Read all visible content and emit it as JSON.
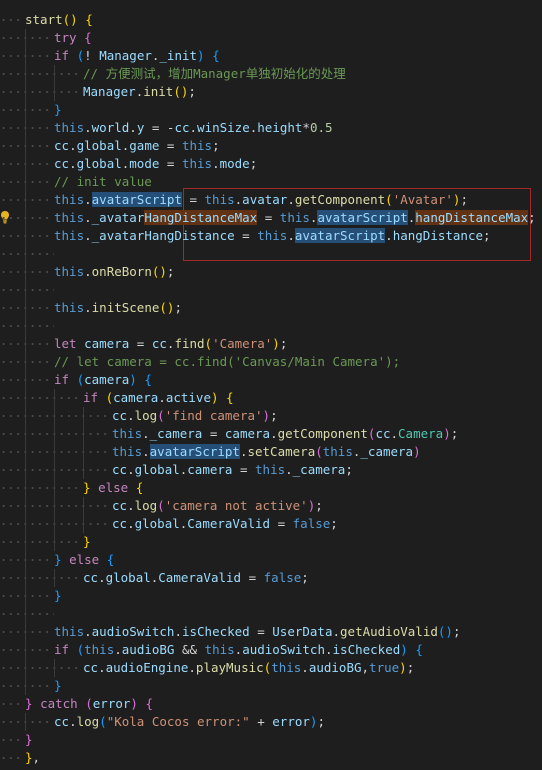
{
  "editor": {
    "language": "javascript",
    "lines": [
      {
        "indent": 0,
        "tokens": [
          [
            "fn",
            "start"
          ],
          [
            "br1",
            "()"
          ],
          [
            "gc",
            " "
          ],
          [
            "br1",
            "{"
          ]
        ]
      },
      {
        "indent": 1,
        "tokens": [
          [
            "kw",
            "try"
          ],
          [
            "gc",
            " "
          ],
          [
            "br2",
            "{"
          ]
        ]
      },
      {
        "indent": 1,
        "tokens": [
          [
            "kw",
            "if"
          ],
          [
            "gc",
            " "
          ],
          [
            "br3",
            "("
          ],
          [
            "gc",
            "! "
          ],
          [
            "pr",
            "Manager"
          ],
          [
            "gc",
            "."
          ],
          [
            "pr",
            "_init"
          ],
          [
            "br3",
            ")"
          ],
          [
            "gc",
            " "
          ],
          [
            "br3",
            "{"
          ]
        ]
      },
      {
        "indent": 2,
        "tokens": [
          [
            "cm",
            "// 方便测试，增加Manager单独初始化的处理"
          ]
        ]
      },
      {
        "indent": 2,
        "tokens": [
          [
            "pr",
            "Manager"
          ],
          [
            "gc",
            "."
          ],
          [
            "fn",
            "init"
          ],
          [
            "br1",
            "()"
          ],
          [
            "gc",
            ";"
          ]
        ]
      },
      {
        "indent": 1,
        "tokens": [
          [
            "br3",
            "}"
          ]
        ]
      },
      {
        "indent": 1,
        "tokens": [
          [
            "this",
            "this"
          ],
          [
            "gc",
            "."
          ],
          [
            "pr",
            "world"
          ],
          [
            "gc",
            "."
          ],
          [
            "pr",
            "y"
          ],
          [
            "gc",
            " = -"
          ],
          [
            "pr",
            "cc"
          ],
          [
            "gc",
            "."
          ],
          [
            "pr",
            "winSize"
          ],
          [
            "gc",
            "."
          ],
          [
            "pr",
            "height"
          ],
          [
            "gc",
            "*"
          ],
          [
            "num",
            "0.5"
          ]
        ]
      },
      {
        "indent": 1,
        "tokens": [
          [
            "pr",
            "cc"
          ],
          [
            "gc",
            "."
          ],
          [
            "pr",
            "global"
          ],
          [
            "gc",
            "."
          ],
          [
            "pr",
            "game"
          ],
          [
            "gc",
            " = "
          ],
          [
            "this",
            "this"
          ],
          [
            "gc",
            ";"
          ]
        ]
      },
      {
        "indent": 1,
        "tokens": [
          [
            "pr",
            "cc"
          ],
          [
            "gc",
            "."
          ],
          [
            "pr",
            "global"
          ],
          [
            "gc",
            "."
          ],
          [
            "pr",
            "mode"
          ],
          [
            "gc",
            " = "
          ],
          [
            "this",
            "this"
          ],
          [
            "gc",
            "."
          ],
          [
            "pr",
            "mode"
          ],
          [
            "gc",
            ";"
          ]
        ]
      },
      {
        "indent": 1,
        "tokens": [
          [
            "cm",
            "// init value"
          ]
        ]
      },
      {
        "indent": 1,
        "tokens": [
          [
            "this",
            "this"
          ],
          [
            "gc",
            "."
          ],
          [
            "pr hl",
            "avatarScript"
          ],
          [
            "gc",
            " = "
          ],
          [
            "this",
            "this"
          ],
          [
            "gc",
            "."
          ],
          [
            "pr",
            "avatar"
          ],
          [
            "gc",
            "."
          ],
          [
            "fn",
            "getComponent"
          ],
          [
            "br1",
            "("
          ],
          [
            "str",
            "'Avatar'"
          ],
          [
            "br1",
            ")"
          ],
          [
            "gc",
            ";"
          ]
        ]
      },
      {
        "indent": 1,
        "tokens": [
          [
            "this",
            "this"
          ],
          [
            "gc",
            "."
          ],
          [
            "pr",
            "_avatar"
          ],
          [
            "pr hl2",
            "HangDistanceMax"
          ],
          [
            "gc",
            " = "
          ],
          [
            "this",
            "this"
          ],
          [
            "gc",
            "."
          ],
          [
            "pr hl",
            "avatarScript"
          ],
          [
            "gc",
            "."
          ],
          [
            "pr hl2",
            "hangDistanceMax"
          ],
          [
            "gc",
            ";"
          ]
        ]
      },
      {
        "indent": 1,
        "tokens": [
          [
            "this",
            "this"
          ],
          [
            "gc",
            "."
          ],
          [
            "pr",
            "_avatarHangDistance"
          ],
          [
            "gc",
            " = "
          ],
          [
            "this",
            "this"
          ],
          [
            "gc",
            "."
          ],
          [
            "pr hl",
            "avatarScript"
          ],
          [
            "gc",
            "."
          ],
          [
            "pr",
            "hangDistance"
          ],
          [
            "gc",
            ";"
          ]
        ]
      },
      {
        "indent": 1,
        "tokens": []
      },
      {
        "indent": 1,
        "tokens": [
          [
            "this",
            "this"
          ],
          [
            "gc",
            "."
          ],
          [
            "fn",
            "onReBorn"
          ],
          [
            "br1",
            "()"
          ],
          [
            "gc",
            ";"
          ]
        ]
      },
      {
        "indent": 1,
        "tokens": []
      },
      {
        "indent": 1,
        "tokens": [
          [
            "this",
            "this"
          ],
          [
            "gc",
            "."
          ],
          [
            "fn",
            "initScene"
          ],
          [
            "br1",
            "()"
          ],
          [
            "gc",
            ";"
          ]
        ]
      },
      {
        "indent": 1,
        "tokens": []
      },
      {
        "indent": 1,
        "tokens": [
          [
            "kw",
            "let"
          ],
          [
            "gc",
            " "
          ],
          [
            "pr",
            "camera"
          ],
          [
            "gc",
            " = "
          ],
          [
            "pr",
            "cc"
          ],
          [
            "gc",
            "."
          ],
          [
            "fn",
            "find"
          ],
          [
            "br1",
            "("
          ],
          [
            "str",
            "'Camera'"
          ],
          [
            "br1",
            ")"
          ],
          [
            "gc",
            ";"
          ]
        ]
      },
      {
        "indent": 1,
        "tokens": [
          [
            "cm",
            "// let camera = cc.find('Canvas/Main Camera');"
          ]
        ]
      },
      {
        "indent": 1,
        "tokens": [
          [
            "kw",
            "if"
          ],
          [
            "gc",
            " "
          ],
          [
            "br3",
            "("
          ],
          [
            "pr",
            "camera"
          ],
          [
            "br3",
            ")"
          ],
          [
            "gc",
            " "
          ],
          [
            "br3",
            "{"
          ]
        ]
      },
      {
        "indent": 2,
        "tokens": [
          [
            "kw",
            "if"
          ],
          [
            "gc",
            " "
          ],
          [
            "br1",
            "("
          ],
          [
            "pr",
            "camera"
          ],
          [
            "gc",
            "."
          ],
          [
            "pr",
            "active"
          ],
          [
            "br1",
            ")"
          ],
          [
            "gc",
            " "
          ],
          [
            "br1",
            "{"
          ]
        ]
      },
      {
        "indent": 3,
        "tokens": [
          [
            "pr",
            "cc"
          ],
          [
            "gc",
            "."
          ],
          [
            "fn",
            "log"
          ],
          [
            "br2",
            "("
          ],
          [
            "str",
            "'find camera'"
          ],
          [
            "br2",
            ")"
          ],
          [
            "gc",
            ";"
          ]
        ]
      },
      {
        "indent": 3,
        "tokens": [
          [
            "this",
            "this"
          ],
          [
            "gc",
            "."
          ],
          [
            "pr",
            "_camera"
          ],
          [
            "gc",
            " = "
          ],
          [
            "pr",
            "camera"
          ],
          [
            "gc",
            "."
          ],
          [
            "fn",
            "getComponent"
          ],
          [
            "br2",
            "("
          ],
          [
            "pr",
            "cc"
          ],
          [
            "gc",
            "."
          ],
          [
            "cls",
            "Camera"
          ],
          [
            "br2",
            ")"
          ],
          [
            "gc",
            ";"
          ]
        ]
      },
      {
        "indent": 3,
        "tokens": [
          [
            "this",
            "this"
          ],
          [
            "gc",
            "."
          ],
          [
            "pr hl",
            "avatarScript"
          ],
          [
            "gc",
            "."
          ],
          [
            "fn",
            "setCamera"
          ],
          [
            "br2",
            "("
          ],
          [
            "this",
            "this"
          ],
          [
            "gc",
            "."
          ],
          [
            "pr",
            "_camera"
          ],
          [
            "br2",
            ")"
          ]
        ]
      },
      {
        "indent": 3,
        "tokens": [
          [
            "pr",
            "cc"
          ],
          [
            "gc",
            "."
          ],
          [
            "pr",
            "global"
          ],
          [
            "gc",
            "."
          ],
          [
            "pr",
            "camera"
          ],
          [
            "gc",
            " = "
          ],
          [
            "this",
            "this"
          ],
          [
            "gc",
            "."
          ],
          [
            "pr",
            "_camera"
          ],
          [
            "gc",
            ";"
          ]
        ]
      },
      {
        "indent": 2,
        "tokens": [
          [
            "br1",
            "}"
          ],
          [
            "gc",
            " "
          ],
          [
            "kw",
            "else"
          ],
          [
            "gc",
            " "
          ],
          [
            "br1",
            "{"
          ]
        ]
      },
      {
        "indent": 3,
        "tokens": [
          [
            "pr",
            "cc"
          ],
          [
            "gc",
            "."
          ],
          [
            "fn",
            "log"
          ],
          [
            "br2",
            "("
          ],
          [
            "str",
            "'camera not active'"
          ],
          [
            "br2",
            ")"
          ],
          [
            "gc",
            ";"
          ]
        ]
      },
      {
        "indent": 3,
        "tokens": [
          [
            "pr",
            "cc"
          ],
          [
            "gc",
            "."
          ],
          [
            "pr",
            "global"
          ],
          [
            "gc",
            "."
          ],
          [
            "pr",
            "CameraValid"
          ],
          [
            "gc",
            " = "
          ],
          [
            "this",
            "false"
          ],
          [
            "gc",
            ";"
          ]
        ]
      },
      {
        "indent": 2,
        "tokens": [
          [
            "br1",
            "}"
          ]
        ]
      },
      {
        "indent": 1,
        "tokens": [
          [
            "br3",
            "}"
          ],
          [
            "gc",
            " "
          ],
          [
            "kw",
            "else"
          ],
          [
            "gc",
            " "
          ],
          [
            "br3",
            "{"
          ]
        ]
      },
      {
        "indent": 2,
        "tokens": [
          [
            "pr",
            "cc"
          ],
          [
            "gc",
            "."
          ],
          [
            "pr",
            "global"
          ],
          [
            "gc",
            "."
          ],
          [
            "pr",
            "CameraValid"
          ],
          [
            "gc",
            " = "
          ],
          [
            "this",
            "false"
          ],
          [
            "gc",
            ";"
          ]
        ]
      },
      {
        "indent": 1,
        "tokens": [
          [
            "br3",
            "}"
          ]
        ]
      },
      {
        "indent": 1,
        "tokens": []
      },
      {
        "indent": 1,
        "tokens": [
          [
            "this",
            "this"
          ],
          [
            "gc",
            "."
          ],
          [
            "pr",
            "audioSwitch"
          ],
          [
            "gc",
            "."
          ],
          [
            "pr",
            "isChecked"
          ],
          [
            "gc",
            " = "
          ],
          [
            "pr",
            "UserData"
          ],
          [
            "gc",
            "."
          ],
          [
            "fn",
            "getAudioValid"
          ],
          [
            "br3",
            "()"
          ],
          [
            "gc",
            ";"
          ]
        ]
      },
      {
        "indent": 1,
        "tokens": [
          [
            "kw",
            "if"
          ],
          [
            "gc",
            " "
          ],
          [
            "br3",
            "("
          ],
          [
            "this",
            "this"
          ],
          [
            "gc",
            "."
          ],
          [
            "pr",
            "audioBG"
          ],
          [
            "gc",
            " && "
          ],
          [
            "this",
            "this"
          ],
          [
            "gc",
            "."
          ],
          [
            "pr",
            "audioSwitch"
          ],
          [
            "gc",
            "."
          ],
          [
            "pr",
            "isChecked"
          ],
          [
            "br3",
            ")"
          ],
          [
            "gc",
            " "
          ],
          [
            "br3",
            "{"
          ]
        ]
      },
      {
        "indent": 2,
        "tokens": [
          [
            "pr",
            "cc"
          ],
          [
            "gc",
            "."
          ],
          [
            "pr",
            "audioEngine"
          ],
          [
            "gc",
            "."
          ],
          [
            "fn",
            "playMusic"
          ],
          [
            "br1",
            "("
          ],
          [
            "this",
            "this"
          ],
          [
            "gc",
            "."
          ],
          [
            "pr",
            "audioBG"
          ],
          [
            "gc",
            ","
          ],
          [
            "this",
            "true"
          ],
          [
            "br1",
            ")"
          ],
          [
            "gc",
            ";"
          ]
        ]
      },
      {
        "indent": 1,
        "tokens": [
          [
            "br3",
            "}"
          ]
        ]
      },
      {
        "indent": 0,
        "tokens": [
          [
            "br2",
            "}"
          ],
          [
            "gc",
            " "
          ],
          [
            "kw",
            "catch"
          ],
          [
            "gc",
            " "
          ],
          [
            "br2",
            "("
          ],
          [
            "pr",
            "error"
          ],
          [
            "br2",
            ")"
          ],
          [
            "gc",
            " "
          ],
          [
            "br2",
            "{"
          ]
        ]
      },
      {
        "indent": 1,
        "tokens": [
          [
            "pr",
            "cc"
          ],
          [
            "gc",
            "."
          ],
          [
            "fn",
            "log"
          ],
          [
            "br3",
            "("
          ],
          [
            "str",
            "\"Kola Cocos error:\""
          ],
          [
            "gc",
            " + "
          ],
          [
            "pr",
            "error"
          ],
          [
            "br3",
            ")"
          ],
          [
            "gc",
            ";"
          ]
        ]
      },
      {
        "indent": 0,
        "tokens": [
          [
            "br2",
            "}"
          ]
        ]
      },
      {
        "indent": 0,
        "tokens": [
          [
            "br1",
            "}"
          ],
          [
            "gc",
            ","
          ]
        ]
      }
    ]
  },
  "lightbulb": {
    "icon": "lightbulb-icon",
    "color": "#e6b422"
  },
  "colors": {
    "background": "#1e1e1e",
    "selection_border": "#a02a2a"
  }
}
